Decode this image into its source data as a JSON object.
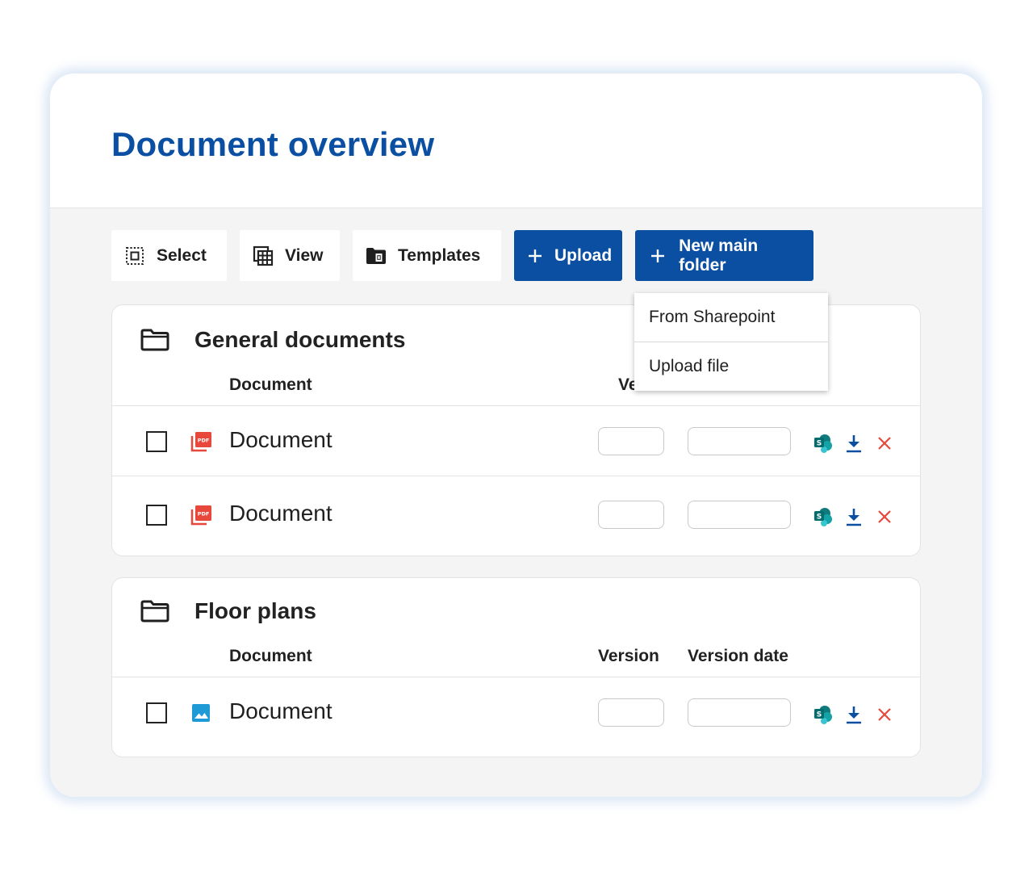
{
  "page": {
    "title": "Document overview"
  },
  "toolbar": {
    "select_label": "Select",
    "view_label": "View",
    "templates_label": "Templates",
    "upload_label": "Upload",
    "new_folder_label": "New main folder"
  },
  "dropdown": {
    "items": [
      {
        "label": "From Sharepoint"
      },
      {
        "label": "Upload file"
      }
    ]
  },
  "folders": [
    {
      "title": "General documents",
      "columns": {
        "document": "Document",
        "version_partial": "Ve"
      },
      "rows": [
        {
          "name": "Document",
          "type": "pdf",
          "version": "",
          "version_date": ""
        },
        {
          "name": "Document",
          "type": "pdf",
          "version": "",
          "version_date": ""
        }
      ]
    },
    {
      "title": "Floor plans",
      "columns": {
        "document": "Document",
        "version": "Version",
        "version_date": "Version date"
      },
      "rows": [
        {
          "name": "Document",
          "type": "image",
          "version": "",
          "version_date": ""
        }
      ]
    }
  ],
  "icons": {
    "folder": "folder-icon",
    "pdf": "pdf-file-icon",
    "image": "image-file-icon",
    "sharepoint": "sharepoint-icon",
    "download": "download-icon",
    "delete": "close-icon"
  },
  "colors": {
    "primary": "#0b4fa3",
    "pdf": "#e8473b",
    "image": "#1e9ad6",
    "sharepoint": "#0f7b7c",
    "delete": "#e8473b"
  }
}
